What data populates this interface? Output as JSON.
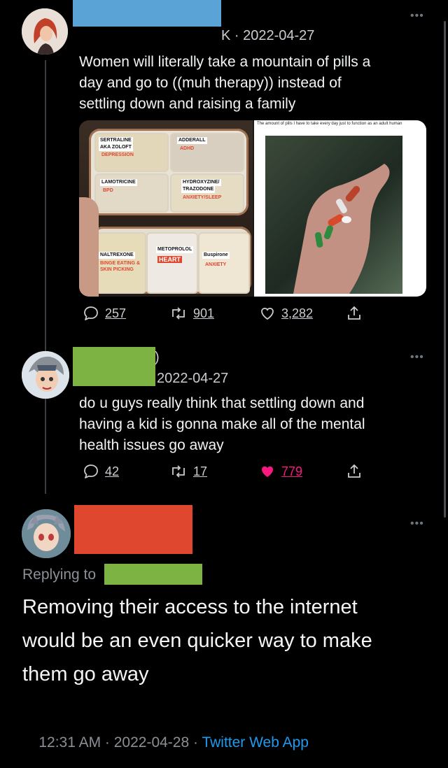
{
  "tweets": [
    {
      "date": "K · 2022-04-27",
      "text_lines": [
        "Women will literally take a mountain of pills a",
        "day and go to ((muh therapy)) instead of",
        "settling down and raising a family"
      ],
      "image": {
        "caption": "The amount of pills I have to take every day just to function as an adult human",
        "pill_labels": {
          "a1": "SERTRALINE",
          "a2": "AKA ZOLOFT",
          "a3": "DEPRESSION",
          "b1": "ADDERALL",
          "b2": "ADHD",
          "c1": "LAMOTRICINE",
          "c2": "BPD",
          "d1": "HYDROXYZINE/",
          "d2": "TRAZODONE",
          "d3": "ANXIETY/SLEEP",
          "e1": "NALTREXONE",
          "e2": "BINGE EATING &",
          "e3": "SKIN PICKING",
          "f1": "METOPROLOL",
          "f2": "HEART",
          "g1": "Buspirone",
          "g2": "ANXIETY"
        }
      },
      "replies": "257",
      "retweets": "901",
      "likes": "3,282"
    },
    {
      "date": "2022-04-27",
      "paren": ")",
      "text_lines": [
        "do u guys really think that settling down and",
        "having a kid is gonna make all of the mental",
        "health issues go away"
      ],
      "replies": "42",
      "retweets": "17",
      "likes": "779"
    },
    {
      "replying_to": "Replying to",
      "text_lines": [
        "Removing their access to the internet",
        "would be an even quicker way to make",
        "them go away"
      ],
      "footer": "12:31 AM · 2022-04-28 · ",
      "source": "Twitter Web App"
    }
  ],
  "colors": {
    "redact_blue": "#5aa3d6",
    "redact_green": "#7cb342",
    "redact_red": "#e0472f",
    "like_pink": "#f91880",
    "link_blue": "#1d9bf0"
  }
}
